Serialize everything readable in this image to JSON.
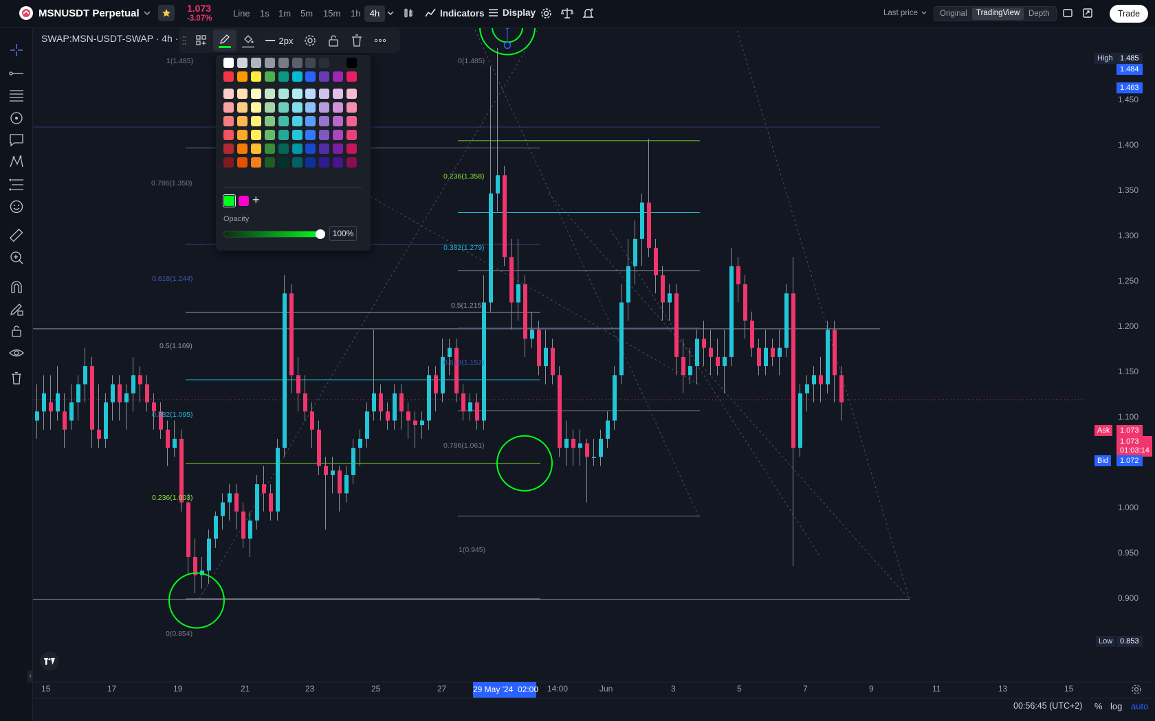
{
  "header": {
    "symbol": "MSNUSDT Perpetual",
    "price": "1.073",
    "change": "-3.07%",
    "intervals": [
      "Line",
      "1s",
      "1m",
      "5m",
      "15m",
      "1h",
      "4h"
    ],
    "active_interval": "4h",
    "indicators_label": "Indicators",
    "display_label": "Display",
    "last_price_label": "Last price",
    "views": [
      "Original",
      "TradingView",
      "Depth"
    ],
    "active_view": "TradingView",
    "trade_label": "Trade"
  },
  "chart": {
    "symbol_label": "SWAP:MSN-USDT-SWAP · 4h ·",
    "line_width_label": "2px"
  },
  "color_popup": {
    "opacity_label": "Opacity",
    "opacity_value": "100%",
    "selected_color": "#00ff1a",
    "recent_colors": [
      "#00ff1a",
      "#ff00cc"
    ],
    "plus_label": "+"
  },
  "price_axis": {
    "ticks": [
      "1.450",
      "1.400",
      "1.350",
      "1.300",
      "1.250",
      "1.200",
      "1.150",
      "1.100",
      "1.000",
      "0.950",
      "0.900"
    ],
    "high_label": "High",
    "high_value": "1.485",
    "marker_1484": "1.484",
    "marker_1463": "1.463",
    "ask_label": "Ask",
    "ask_value": "1.073",
    "current_price": "1.073",
    "countdown": "01:03:14",
    "bid_label": "Bid",
    "bid_value": "1.072",
    "low_label": "Low",
    "low_value": "0.853"
  },
  "time_axis": {
    "labels": [
      "15",
      "17",
      "19",
      "21",
      "23",
      "25",
      "27",
      "14:00",
      "Jun",
      "3",
      "5",
      "7",
      "9",
      "11",
      "13",
      "15"
    ],
    "highlighted": "29 May '24  02:00"
  },
  "fib_left": [
    {
      "label": "1(1.485)",
      "color": "#787b86"
    },
    {
      "label": "0.786(1.350)",
      "color": "#787b86"
    },
    {
      "label": "0.618(1.244)",
      "color": "#2f4a8a"
    },
    {
      "label": "0.5(1.169)",
      "color": "#9598a1"
    },
    {
      "label": "0.382(1.095)",
      "color": "#22b8cf"
    },
    {
      "label": "0.236(1.003)",
      "color": "#7ed321"
    },
    {
      "label": "0(0.854)",
      "color": "#787b86"
    }
  ],
  "fib_right": [
    {
      "label": "0(1.485)",
      "color": "#787b86"
    },
    {
      "label": "0.236(1.358)",
      "color": "#7ed321"
    },
    {
      "label": "0.382(1.279)",
      "color": "#22b8cf"
    },
    {
      "label": "0.5(1.215)",
      "color": "#9598a1"
    },
    {
      "label": "0.618(1.152)",
      "color": "#2f4a8a"
    },
    {
      "label": "0.786(1.061)",
      "color": "#787b86"
    },
    {
      "label": "1(0.945)",
      "color": "#787b86"
    }
  ],
  "footer": {
    "clock": "00:56:45 (UTC+2)",
    "percent_label": "%",
    "log_label": "log",
    "auto_label": "auto"
  },
  "colors": {
    "up": "#22c6d6",
    "down": "#f0366d",
    "accent_green": "#00ff1a"
  }
}
